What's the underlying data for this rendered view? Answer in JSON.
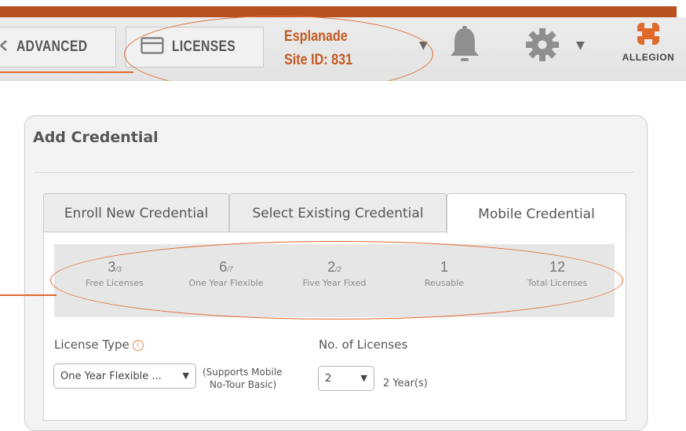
{
  "header": {
    "advanced_label": "ADVANCED",
    "licenses_label": "LICENSES",
    "site_name": "Esplanade",
    "site_id": "Site ID: 831",
    "logo_text": "ALLEGION",
    "colors": {
      "brand_orange": "#b8511f",
      "site_text": "#c45a22",
      "callout": "#e0692e"
    }
  },
  "panel": {
    "title": "Add Credential",
    "tabs": [
      {
        "label": "Enroll New Credential",
        "active": false
      },
      {
        "label": "Select Existing Credential",
        "active": false
      },
      {
        "label": "Mobile Credential",
        "active": true
      }
    ]
  },
  "stats": [
    {
      "value": "3",
      "of": "/3",
      "caption": "Free Licenses"
    },
    {
      "value": "6",
      "of": "/7",
      "caption": "One Year Flexible"
    },
    {
      "value": "2",
      "of": "/2",
      "caption": "Five Year Fixed"
    },
    {
      "value": "1",
      "of": "",
      "caption": "Reusable"
    },
    {
      "value": "12",
      "of": "",
      "caption": "Total Licenses"
    }
  ],
  "form": {
    "license_type_label": "License Type",
    "license_type_value": "One Year Flexible ...",
    "license_note_1": "(Supports Mobile",
    "license_note_2": "No-Tour Basic)",
    "num_licenses_label": "No. of Licenses",
    "num_licenses_value": "2",
    "duration_text": "2 Year(s)"
  },
  "icons": [
    "sync-icon",
    "license-card-icon",
    "chevron-down-icon",
    "bell-icon",
    "gear-icon",
    "allegion-logo",
    "info-icon"
  ]
}
